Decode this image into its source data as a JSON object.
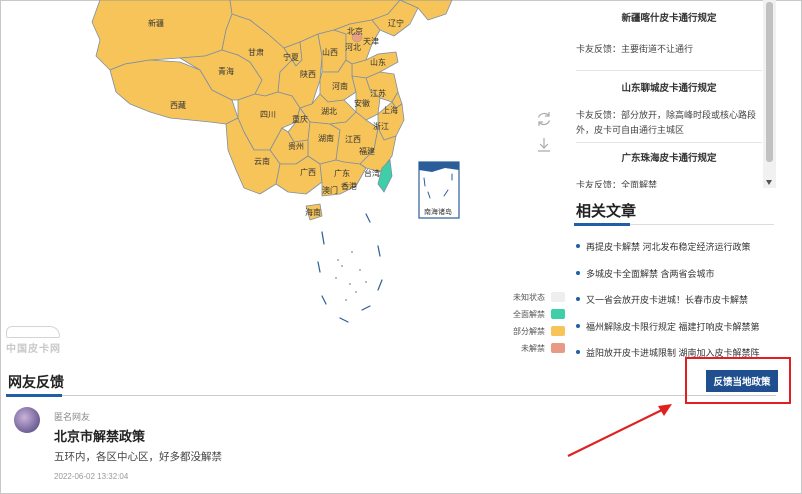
{
  "map": {
    "provinces": {
      "xinjiang": "新疆",
      "xizang": "西藏",
      "qinghai": "青海",
      "gansu": "甘肃",
      "ningxia": "宁夏",
      "shanxi": "山西",
      "shaanxi": "陕西",
      "beijing": "北京",
      "tianjin": "天津",
      "liaoning": "辽宁",
      "hebei": "河北",
      "shandong": "山东",
      "henan": "河南",
      "jiangsu": "江苏",
      "anhui": "安徽",
      "shanghai": "上海",
      "sichuan": "四川",
      "hubei": "湖北",
      "zhejiang": "浙江",
      "chongqing": "重庆",
      "guizhou": "贵州",
      "hunan": "湖南",
      "jiangxi": "江西",
      "fujian": "福建",
      "yunnan": "云南",
      "guangxi": "广西",
      "guangdong": "广东",
      "taiwan": "台湾",
      "aomen": "澳门",
      "xianggang": "香港",
      "hainan": "海南",
      "nanhai": "南海诸岛"
    },
    "colors": {
      "partial": "#f7c45a",
      "full": "#3ecfa8",
      "not_lifted": "#e99a86",
      "unknown": "#eeeeee",
      "border": "#7d8fa3",
      "sea": "#2a5d9a"
    }
  },
  "legend": {
    "unknown": "未知状态",
    "full": "全面解禁",
    "partial": "部分解禁",
    "not_lifted": "未解禁"
  },
  "watermark": "中国皮卡网",
  "policies": [
    {
      "title": "新疆喀什皮卡通行规定",
      "text": "卡友反馈：主要街道不让通行"
    },
    {
      "title": "山东聊城皮卡通行规定",
      "text": "卡友反馈：部分放开，除高峰时段或核心路段外，皮卡可自由通行主城区"
    },
    {
      "title": "广东珠海皮卡通行规定",
      "text": "卡友反馈：全面解禁"
    }
  ],
  "related": {
    "heading": "相关文章",
    "items": [
      "再提皮卡解禁 河北发布稳定经济运行政策",
      "多城皮卡全面解禁 含两省会城市",
      "又一省会放开皮卡进城！长春市皮卡解禁",
      "福州解除皮卡限行规定 福建打响皮卡解禁第",
      "益阳放开皮卡进城限制 湖南加入皮卡解禁阵"
    ]
  },
  "feedback": {
    "heading": "网友反馈",
    "button_label": "反馈当地政策",
    "post": {
      "user": "匿名网友",
      "title": "北京市解禁政策",
      "body": "五环内，各区中心区，好多都没解禁",
      "time": "2022-06-02 13:32:04"
    }
  }
}
